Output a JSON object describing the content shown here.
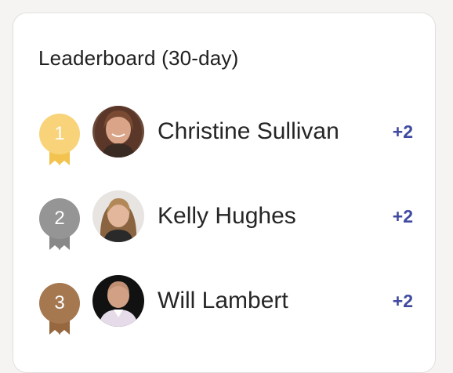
{
  "leaderboard": {
    "title": "Leaderboard (30-day)",
    "entries": [
      {
        "rank": "1",
        "name": "Christine Sullivan",
        "points": "+2",
        "medal_color": "#f8d37a",
        "ribbon_color": "#f2c44f"
      },
      {
        "rank": "2",
        "name": "Kelly Hughes",
        "points": "+2",
        "medal_color": "#959595",
        "ribbon_color": "#888888"
      },
      {
        "rank": "3",
        "name": "Will Lambert",
        "points": "+2",
        "medal_color": "#a57850",
        "ribbon_color": "#97683f"
      }
    ]
  },
  "colors": {
    "points_color": "#3f4aa0",
    "card_background": "#ffffff",
    "page_background": "#f5f4f2"
  }
}
